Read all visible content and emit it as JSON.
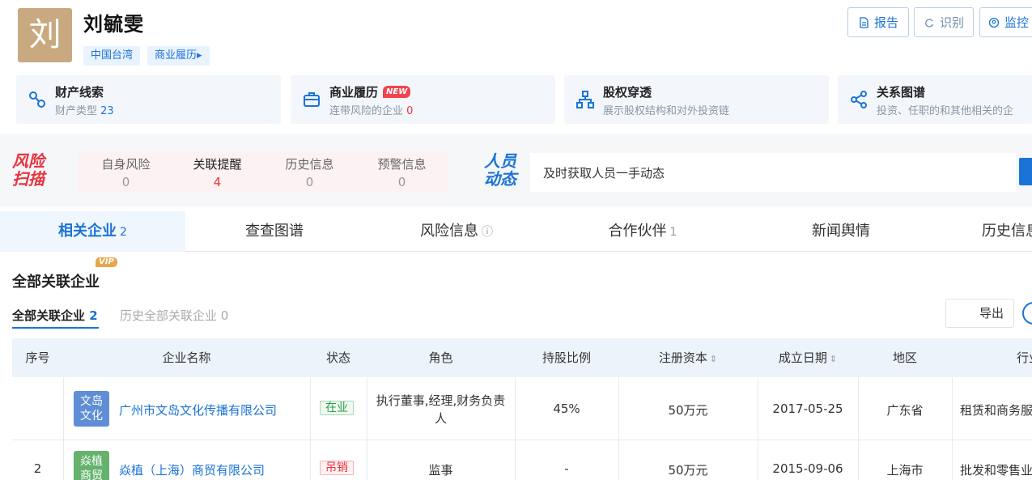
{
  "person": {
    "avatar_char": "刘",
    "name": "刘毓雯",
    "tags": [
      "中国台湾",
      "商业履历▸"
    ]
  },
  "header_buttons": [
    "报告",
    "识别",
    "监控"
  ],
  "cards": [
    {
      "title": "财产线索",
      "subtitle_prefix": "财产类型 ",
      "subtitle_value": "23",
      "icon": "link-icon"
    },
    {
      "title": "商业履历",
      "badge": "NEW",
      "subtitle_prefix": "连带风险的企业 ",
      "subtitle_value": "0",
      "icon": "briefcase-icon"
    },
    {
      "title": "股权穿透",
      "subtitle_prefix": "展示股权结构和对外投资链",
      "subtitle_value": "",
      "icon": "org-chart-icon"
    },
    {
      "title": "关系图谱",
      "subtitle_prefix": "投资、任职的和其他相关的企",
      "subtitle_value": "",
      "icon": "share-icon"
    }
  ],
  "risk": {
    "logo_line1": "风险",
    "logo_line2": "扫描",
    "items": [
      {
        "label": "自身风险",
        "value": "0"
      },
      {
        "label": "关联提醒",
        "value": "4"
      },
      {
        "label": "历史信息",
        "value": "0"
      },
      {
        "label": "预警信息",
        "value": "0"
      }
    ]
  },
  "dynamic": {
    "logo_line1": "人员",
    "logo_line2": "动态",
    "text": "及时获取人员一手动态"
  },
  "tabs": [
    {
      "label": "相关企业",
      "count": "2"
    },
    {
      "label": "查查图谱",
      "count": ""
    },
    {
      "label": "风险信息",
      "count": ""
    },
    {
      "label": "合作伙伴",
      "count": "1"
    },
    {
      "label": "新闻舆情",
      "count": ""
    },
    {
      "label": "历史信息",
      "count": ""
    }
  ],
  "section": {
    "title": "全部关联企业",
    "vip": "VIP",
    "subtab1_label": "全部关联企业",
    "subtab1_count": "2",
    "subtab2": "历史全部关联企业 0",
    "export": "导出"
  },
  "table": {
    "headers": [
      "序号",
      "企业名称",
      "状态",
      "角色",
      "持股比例",
      "注册资本",
      "成立日期",
      "地区",
      "行业"
    ],
    "rows": [
      {
        "index": "",
        "logo": [
          "文岛",
          "文化"
        ],
        "name": "广州市文岛文化传播有限公司",
        "status": "在业",
        "role": "执行董事,经理,财务负责人",
        "share": "45%",
        "capital": "50万元",
        "date": "2017-05-25",
        "region": "广东省",
        "industry": "租赁和商务服务"
      },
      {
        "index": "2",
        "logo": [
          "焱植",
          "商贸"
        ],
        "name": "焱植（上海）商贸有限公司",
        "status": "吊销",
        "role": "监事",
        "share": "-",
        "capital": "50万元",
        "date": "2015-09-06",
        "region": "上海市",
        "industry": "批发和零售业"
      }
    ]
  },
  "colors": {
    "accent": "#1a73d6",
    "risk_red": "#e8333c",
    "ok_green": "#2e9b45",
    "avatar": "#c9a97f"
  }
}
